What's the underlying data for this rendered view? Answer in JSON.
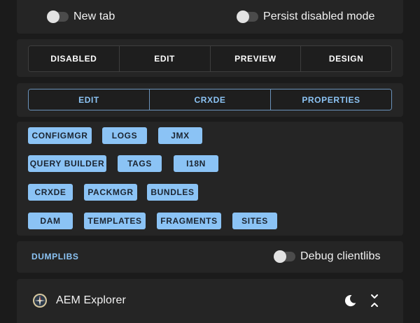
{
  "toggles": {
    "new_tab": {
      "label": "New tab",
      "on": false
    },
    "persist_disabled": {
      "label": "Persist disabled mode",
      "on": false
    }
  },
  "modes": [
    {
      "label": "DISABLED"
    },
    {
      "label": "EDIT"
    },
    {
      "label": "PREVIEW"
    },
    {
      "label": "DESIGN"
    }
  ],
  "links": [
    {
      "label": "EDIT"
    },
    {
      "label": "CRXDE"
    },
    {
      "label": "PROPERTIES"
    }
  ],
  "tools": {
    "rows": [
      [
        "CONFIGMGR",
        "LOGS",
        "JMX"
      ],
      [
        "QUERY BUILDER",
        "TAGS",
        "I18N"
      ],
      [
        "CRXDE",
        "PACKMGR",
        "BUNDLES"
      ],
      [
        "DAM",
        "TEMPLATES",
        "FRAGMENTS",
        "SITES"
      ]
    ]
  },
  "dumplibs": {
    "label": "DUMPLIBS",
    "debug_toggle": {
      "label": "Debug clientlibs",
      "on": false
    }
  },
  "footer": {
    "title": "AEM Explorer",
    "icons": [
      "compass-logo-icon",
      "moon-icon",
      "collapse-icon"
    ]
  },
  "colors": {
    "accent": "#8bc3f5",
    "panel": "#252525",
    "background": "#1b1b1b"
  }
}
